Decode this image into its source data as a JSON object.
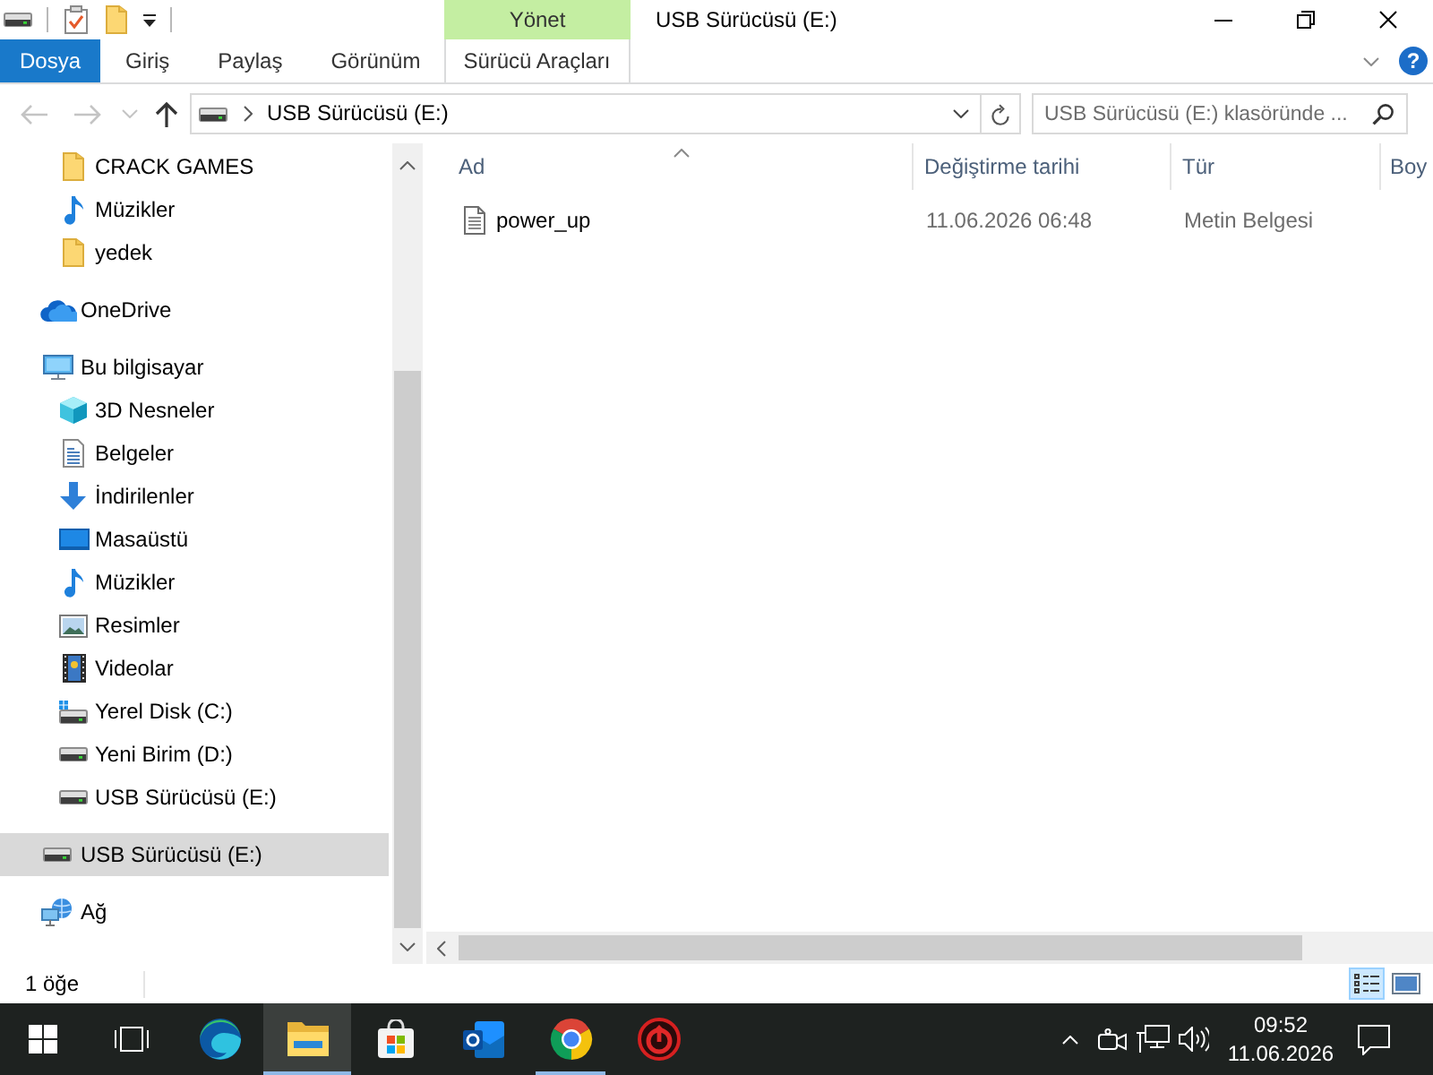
{
  "title_bar": {
    "context_group": "Yönet",
    "title": "USB Sürücüsü (E:)"
  },
  "ribbon": {
    "tabs": [
      {
        "label": "Dosya",
        "kind": "file",
        "selected": false
      },
      {
        "label": "Giriş",
        "kind": "tab",
        "selected": false
      },
      {
        "label": "Paylaş",
        "kind": "tab",
        "selected": false
      },
      {
        "label": "Görünüm",
        "kind": "tab",
        "selected": false
      },
      {
        "label": "Sürücü Araçları",
        "kind": "context",
        "selected": false
      }
    ],
    "help": "?"
  },
  "address_bar": {
    "nav_buttons": [
      {
        "kind": "back",
        "disabled": true
      },
      {
        "kind": "forward",
        "disabled": true
      },
      {
        "kind": "recent",
        "disabled": true
      },
      {
        "kind": "up",
        "disabled": false
      }
    ],
    "path": [
      "USB Sürücüsü (E:)"
    ]
  },
  "search": {
    "placeholder": "USB Sürücüsü (E:) klasöründe ..."
  },
  "navigation_pane": {
    "items": [
      {
        "children": [
          {
            "label": "CRACK GAMES",
            "kind": "folder",
            "selected": false
          },
          {
            "label": "Müzikler",
            "kind": "music",
            "selected": false
          },
          {
            "label": "yedek",
            "kind": "folder",
            "selected": false
          }
        ]
      },
      {
        "label": "OneDrive",
        "kind": "cloud",
        "selected": false
      },
      {
        "label": "Bu bilgisayar",
        "kind": "pc",
        "selected": false,
        "children": [
          {
            "label": "3D Nesneler",
            "kind": "objects3d",
            "selected": false
          },
          {
            "label": "Belgeler",
            "kind": "documents",
            "selected": false
          },
          {
            "label": "İndirilenler",
            "kind": "downloads",
            "selected": false
          },
          {
            "label": "Masaüstü",
            "kind": "desktop",
            "selected": false
          },
          {
            "label": "Müzikler",
            "kind": "music",
            "selected": false
          },
          {
            "label": "Resimler",
            "kind": "pictures",
            "selected": false
          },
          {
            "label": "Videolar",
            "kind": "videos",
            "selected": false
          },
          {
            "label": "Yerel Disk (C:)",
            "kind": "system_drive",
            "selected": false
          },
          {
            "label": "Yeni Birim (D:)",
            "kind": "drive",
            "selected": false
          },
          {
            "label": "USB Sürücüsü (E:)",
            "kind": "drive",
            "selected": false
          }
        ]
      },
      {
        "label": "USB Sürücüsü (E:)",
        "kind": "drive",
        "selected": true
      },
      {
        "label": "Ağ",
        "kind": "network",
        "selected": false
      }
    ]
  },
  "file_list": {
    "columns": [
      {
        "label": "Ad",
        "sorted": true
      },
      {
        "label": "Değiştirme tarihi",
        "sorted": false
      },
      {
        "label": "Tür",
        "sorted": false
      },
      {
        "label": "Boy",
        "sorted": false
      }
    ],
    "rows": [
      {
        "kind": "text_file",
        "name": "power_up",
        "modified": "11.06.2026 06:48",
        "type": "Metin Belgesi",
        "selected": false
      }
    ]
  },
  "status_bar": {
    "item_count": "1 öğe",
    "views": [
      {
        "kind": "details",
        "selected": true
      },
      {
        "kind": "large_icons",
        "selected": false
      }
    ]
  },
  "taskbar": {
    "apps": [
      {
        "kind": "edge",
        "running": false,
        "selected": false
      },
      {
        "kind": "explorer",
        "running": true,
        "selected": true
      },
      {
        "kind": "store",
        "running": false,
        "selected": false
      },
      {
        "kind": "outlook",
        "running": false,
        "selected": false
      },
      {
        "kind": "chrome",
        "running": true,
        "selected": false
      },
      {
        "kind": "app",
        "running": false,
        "selected": false
      }
    ],
    "clock": {
      "time": "09:52",
      "date": "11.06.2026"
    }
  }
}
